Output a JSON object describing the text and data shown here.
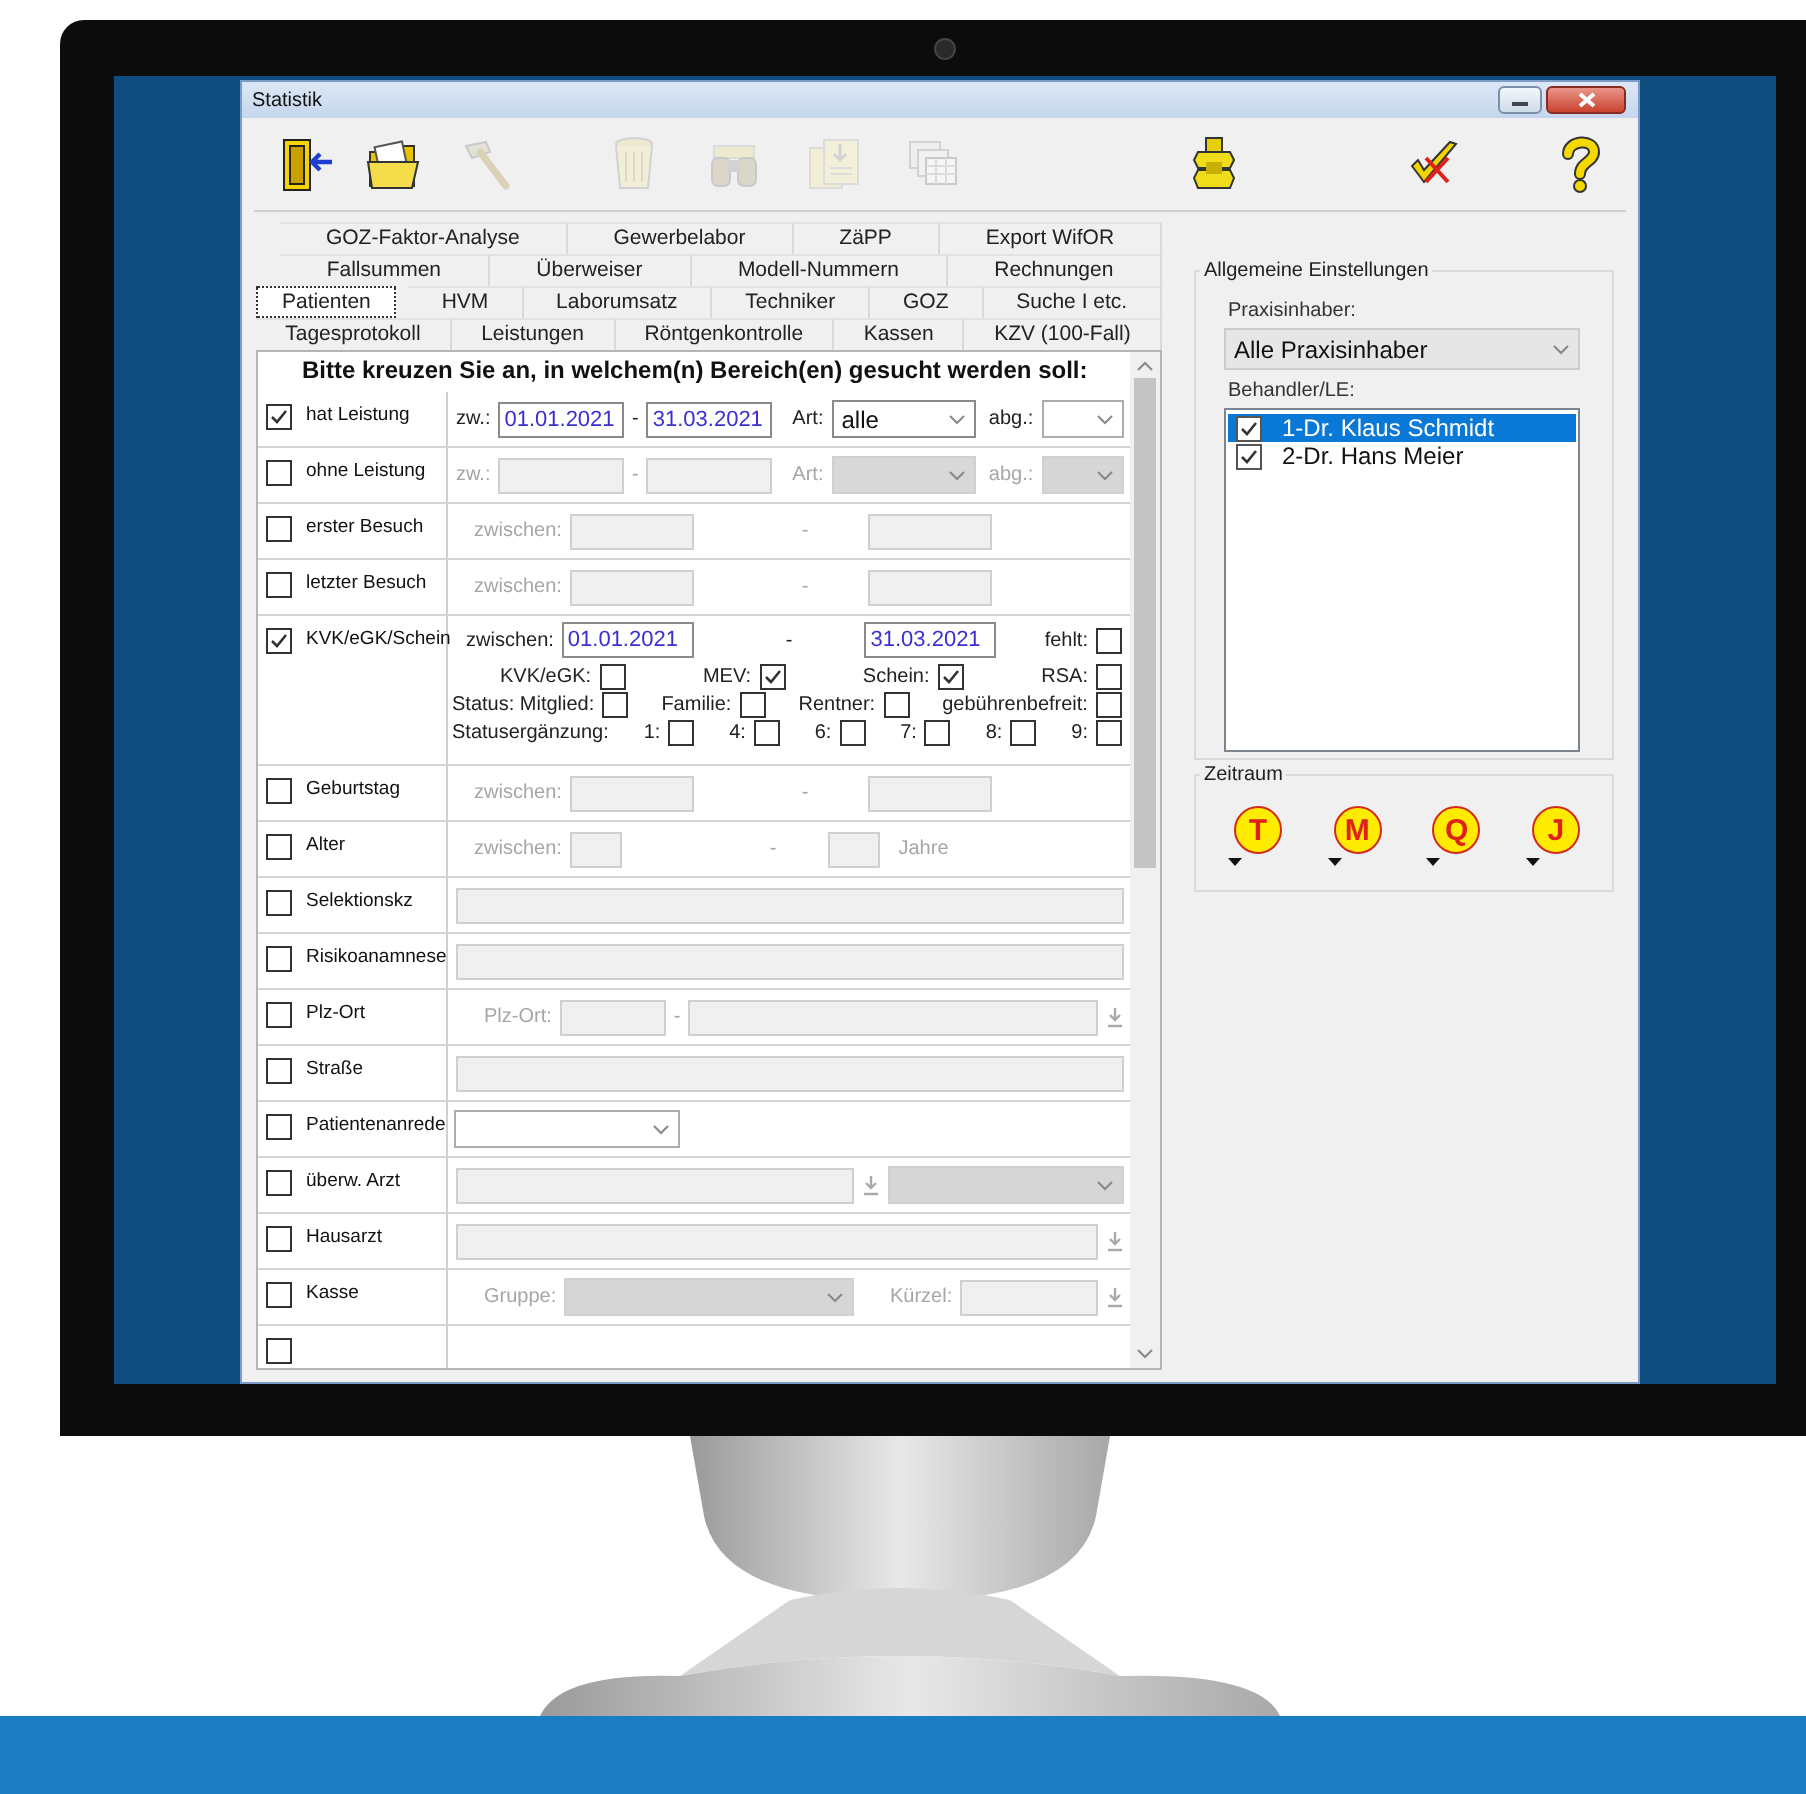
{
  "window": {
    "title": "Statistik"
  },
  "toolbar": {
    "groups": [
      [
        {
          "kind": "exit",
          "disabled": false
        },
        {
          "kind": "folder",
          "disabled": false
        },
        {
          "kind": "hammer",
          "disabled": true
        }
      ],
      [
        {
          "kind": "trash",
          "disabled": true
        },
        {
          "kind": "binoculars",
          "disabled": true
        },
        {
          "kind": "import",
          "disabled": true
        },
        {
          "kind": "tables",
          "disabled": true
        }
      ],
      [
        {
          "kind": "bolts",
          "disabled": false
        }
      ],
      [
        {
          "kind": "checkcross",
          "disabled": false
        }
      ],
      [
        {
          "kind": "help",
          "disabled": false
        }
      ]
    ]
  },
  "tabs": [
    [
      {
        "label": "GOZ-Faktor-Analyse",
        "selected": false
      },
      {
        "label": "Gewerbelabor",
        "selected": false
      },
      {
        "label": "ZäPP",
        "selected": false
      },
      {
        "label": "Export WifOR",
        "selected": false
      }
    ],
    [
      {
        "label": "Fallsummen",
        "selected": false
      },
      {
        "label": "Überweiser",
        "selected": false
      },
      {
        "label": "Modell-Nummern",
        "selected": false
      },
      {
        "label": "Rechnungen",
        "selected": false
      }
    ],
    [
      {
        "label": "Patienten",
        "selected": true
      },
      {
        "label": "HVM",
        "selected": false
      },
      {
        "label": "Laborumsatz",
        "selected": false
      },
      {
        "label": "Techniker",
        "selected": false
      },
      {
        "label": "GOZ",
        "selected": false
      },
      {
        "label": "Suche I etc.",
        "selected": false
      }
    ],
    [
      {
        "label": "Tagesprotokoll",
        "selected": false
      },
      {
        "label": "Leistungen",
        "selected": false
      },
      {
        "label": "Röntgenkontrolle",
        "selected": false
      },
      {
        "label": "Kassen",
        "selected": false
      },
      {
        "label": "KZV (100-Fall)",
        "selected": false
      }
    ]
  ],
  "criteria": {
    "heading": "Bitte kreuzen Sie an, in welchem(n) Bereich(en) gesucht werden soll:",
    "rows": [
      {
        "kind": "range",
        "label": "hat Leistung",
        "checked": true,
        "disabled": false,
        "prefix": "zw.:",
        "from": "01.01.2021",
        "separator": "-",
        "to": "31.03.2021",
        "type_label": "Art:",
        "type_value": "alle",
        "billed_label": "abg.:"
      },
      {
        "kind": "range",
        "label": "ohne Leistung",
        "checked": false,
        "disabled": true,
        "prefix": "zw.:",
        "separator": "-",
        "type_label": "Art:",
        "billed_label": "abg.:"
      },
      {
        "kind": "between",
        "label": "erster Besuch",
        "checked": false,
        "disabled": true,
        "prefix": "zwischen:",
        "separator": "-"
      },
      {
        "kind": "between",
        "label": "letzter Besuch",
        "checked": false,
        "disabled": true,
        "prefix": "zwischen:",
        "separator": "-"
      },
      {
        "kind": "card",
        "label": "KVK/eGK/Schein",
        "checked": true,
        "prefix": "zwischen:",
        "from": "01.01.2021",
        "separator": "-",
        "to": "31.03.2021",
        "missing": {
          "label": "fehlt:",
          "checked": false
        },
        "lines": [
          {
            "items": [
              {
                "label": "KVK/eGK:",
                "checked": false
              },
              {
                "label": "MEV:",
                "checked": true
              },
              {
                "label": "Schein:",
                "checked": true
              },
              {
                "label": "RSA:",
                "checked": false
              }
            ]
          },
          {
            "items": [
              {
                "label": "Status: Mitglied:",
                "checked": false
              },
              {
                "label": "Familie:",
                "checked": false
              },
              {
                "label": "Rentner:",
                "checked": false
              },
              {
                "label": "gebührenbefreit:",
                "checked": false
              }
            ]
          },
          {
            "lead": "Statusergänzung:",
            "items": [
              {
                "label": "1:",
                "checked": false
              },
              {
                "label": "4:",
                "checked": false
              },
              {
                "label": "6:",
                "checked": false
              },
              {
                "label": "7:",
                "checked": false
              },
              {
                "label": "8:",
                "checked": false
              },
              {
                "label": "9:",
                "checked": false
              }
            ]
          }
        ]
      },
      {
        "kind": "between",
        "label": "Geburtstag",
        "checked": false,
        "disabled": true,
        "prefix": "zwischen:",
        "separator": "-"
      },
      {
        "kind": "age",
        "label": "Alter",
        "checked": false,
        "disabled": true,
        "prefix": "zwischen:",
        "separator": "-",
        "suffix": "Jahre"
      },
      {
        "kind": "text",
        "label": "Selektionskz",
        "checked": false
      },
      {
        "kind": "text",
        "label": "Risikoanamnese",
        "checked": false
      },
      {
        "kind": "place",
        "label": "Plz-Ort",
        "checked": false,
        "disabled": true,
        "prefix": "Plz-Ort:",
        "separator": "-"
      },
      {
        "kind": "text",
        "label": "Straße",
        "checked": false
      },
      {
        "kind": "combo",
        "label": "Patientenanrede",
        "checked": false
      },
      {
        "kind": "referrer",
        "label": "überw. Arzt",
        "checked": false
      },
      {
        "kind": "lookup",
        "label": "Hausarzt",
        "checked": false
      },
      {
        "kind": "fund",
        "label": "Kasse",
        "checked": false,
        "disabled": true,
        "group_label": "Gruppe:",
        "code_label": "Kürzel:"
      },
      {
        "kind": "partial",
        "checked": false
      }
    ]
  },
  "settings": {
    "title": "Allgemeine Einstellungen",
    "owner_label": "Praxisinhaber:",
    "owner_value": "Alle Praxisinhaber",
    "practitioners_label": "Behandler/LE:",
    "practitioners": [
      {
        "label": "1-Dr. Klaus Schmidt",
        "checked": true,
        "selected": true
      },
      {
        "label": "2-Dr. Hans Meier",
        "checked": true,
        "selected": false
      }
    ]
  },
  "period": {
    "title": "Zeitraum",
    "buttons": [
      {
        "label": "T"
      },
      {
        "label": "M"
      },
      {
        "label": "Q"
      },
      {
        "label": "J"
      }
    ]
  }
}
